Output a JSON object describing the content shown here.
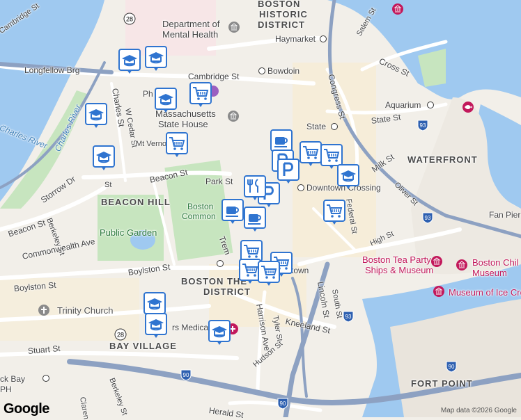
{
  "map": {
    "districts": [
      "BOSTON",
      "HISTORIC",
      "DISTRICT",
      "WATERFRONT",
      "BEACON HILL",
      "BOSTON THE",
      "DISTRICT",
      "BAY VILLAGE",
      "FORT POINT"
    ],
    "labels": {
      "department": "Department of",
      "mental_health": "Mental Health",
      "haymarket": "Haymarket",
      "longfellow": "Longfellow Brg",
      "cambridge_st": "Cambridge St",
      "bowdoin": "Bowdoin",
      "salem_st": "Salem St",
      "cross_st": "Cross St",
      "congress_st": "Congress St",
      "aquarium": "Aquarium",
      "state_st_e": "State St",
      "state": "State",
      "charles_st": "Charles St",
      "w_cedar": "W Cedar St",
      "ph": "Ph",
      "massachusetts": "Massachusetts",
      "state_house": "State House",
      "mt_vernon": "Mt Vernon",
      "charles_river": "Charles River",
      "charles_river_2": "Charles River",
      "storrow": "Storrow Dr",
      "beacon_st": "Beacon St",
      "park_st": "Park St",
      "downtown": "Downtown Crossing",
      "milk_st": "Milk St",
      "oliver_st": "Oliver St",
      "federal_st": "Federal St",
      "boston_common_1": "Boston",
      "boston_common_2": "Common",
      "public_garden": "Public Garden",
      "beacon_st_w": "Beacon St",
      "berkeley": "Berkeley St",
      "commonwealth": "Commonwealth Ave",
      "boylston_st": "Boylston St",
      "boylston_st_2": "Boylston St",
      "trinity": "Trinity Church",
      "tremont": "Trem",
      "high_st": "High St",
      "lincoln_st": "Lincoln St",
      "south_st": "South St",
      "harrison": "Harrison Ave",
      "tyler": "Tyler St",
      "kneeland": "Kneeland St",
      "hudson": "Hudson St",
      "herald": "Herald St",
      "stuart": "Stuart St",
      "berkeley_s": "Berkeley St",
      "clarendon": "Claren",
      "medical": "rs Medical",
      "town": "town",
      "tea_party_1": "Boston Tea Party",
      "tea_party_2": "Ships & Museum",
      "children_1": "Boston Chil",
      "children_2": "Museum",
      "ice_cream": "Museum of Ice Crean",
      "fan_pier": "Fan Pier",
      "ck_bay": "ck Bay",
      "ph2": "PH",
      "cambridge": "Cambridge St",
      "st": "St"
    },
    "shields": [
      "28",
      "28",
      "93",
      "93",
      "93",
      "90",
      "90",
      "90"
    ],
    "markers": [
      {
        "type": "school"
      },
      {
        "type": "school"
      },
      {
        "type": "school"
      },
      {
        "type": "school"
      },
      {
        "type": "school"
      },
      {
        "type": "grocery"
      },
      {
        "type": "grocery"
      },
      {
        "type": "grocery"
      },
      {
        "type": "grocery"
      },
      {
        "type": "grocery"
      },
      {
        "type": "grocery"
      },
      {
        "type": "grocery"
      },
      {
        "type": "grocery"
      },
      {
        "type": "grocery"
      },
      {
        "type": "coffee"
      },
      {
        "type": "coffee"
      },
      {
        "type": "coffee"
      },
      {
        "type": "parking"
      },
      {
        "type": "parking"
      },
      {
        "type": "parking"
      },
      {
        "type": "restaurant"
      },
      {
        "type": "school"
      },
      {
        "type": "school"
      },
      {
        "type": "school"
      },
      {
        "type": "school"
      }
    ]
  },
  "footer": {
    "logo": "Google",
    "attribution": "Map data ©2026 Google"
  }
}
